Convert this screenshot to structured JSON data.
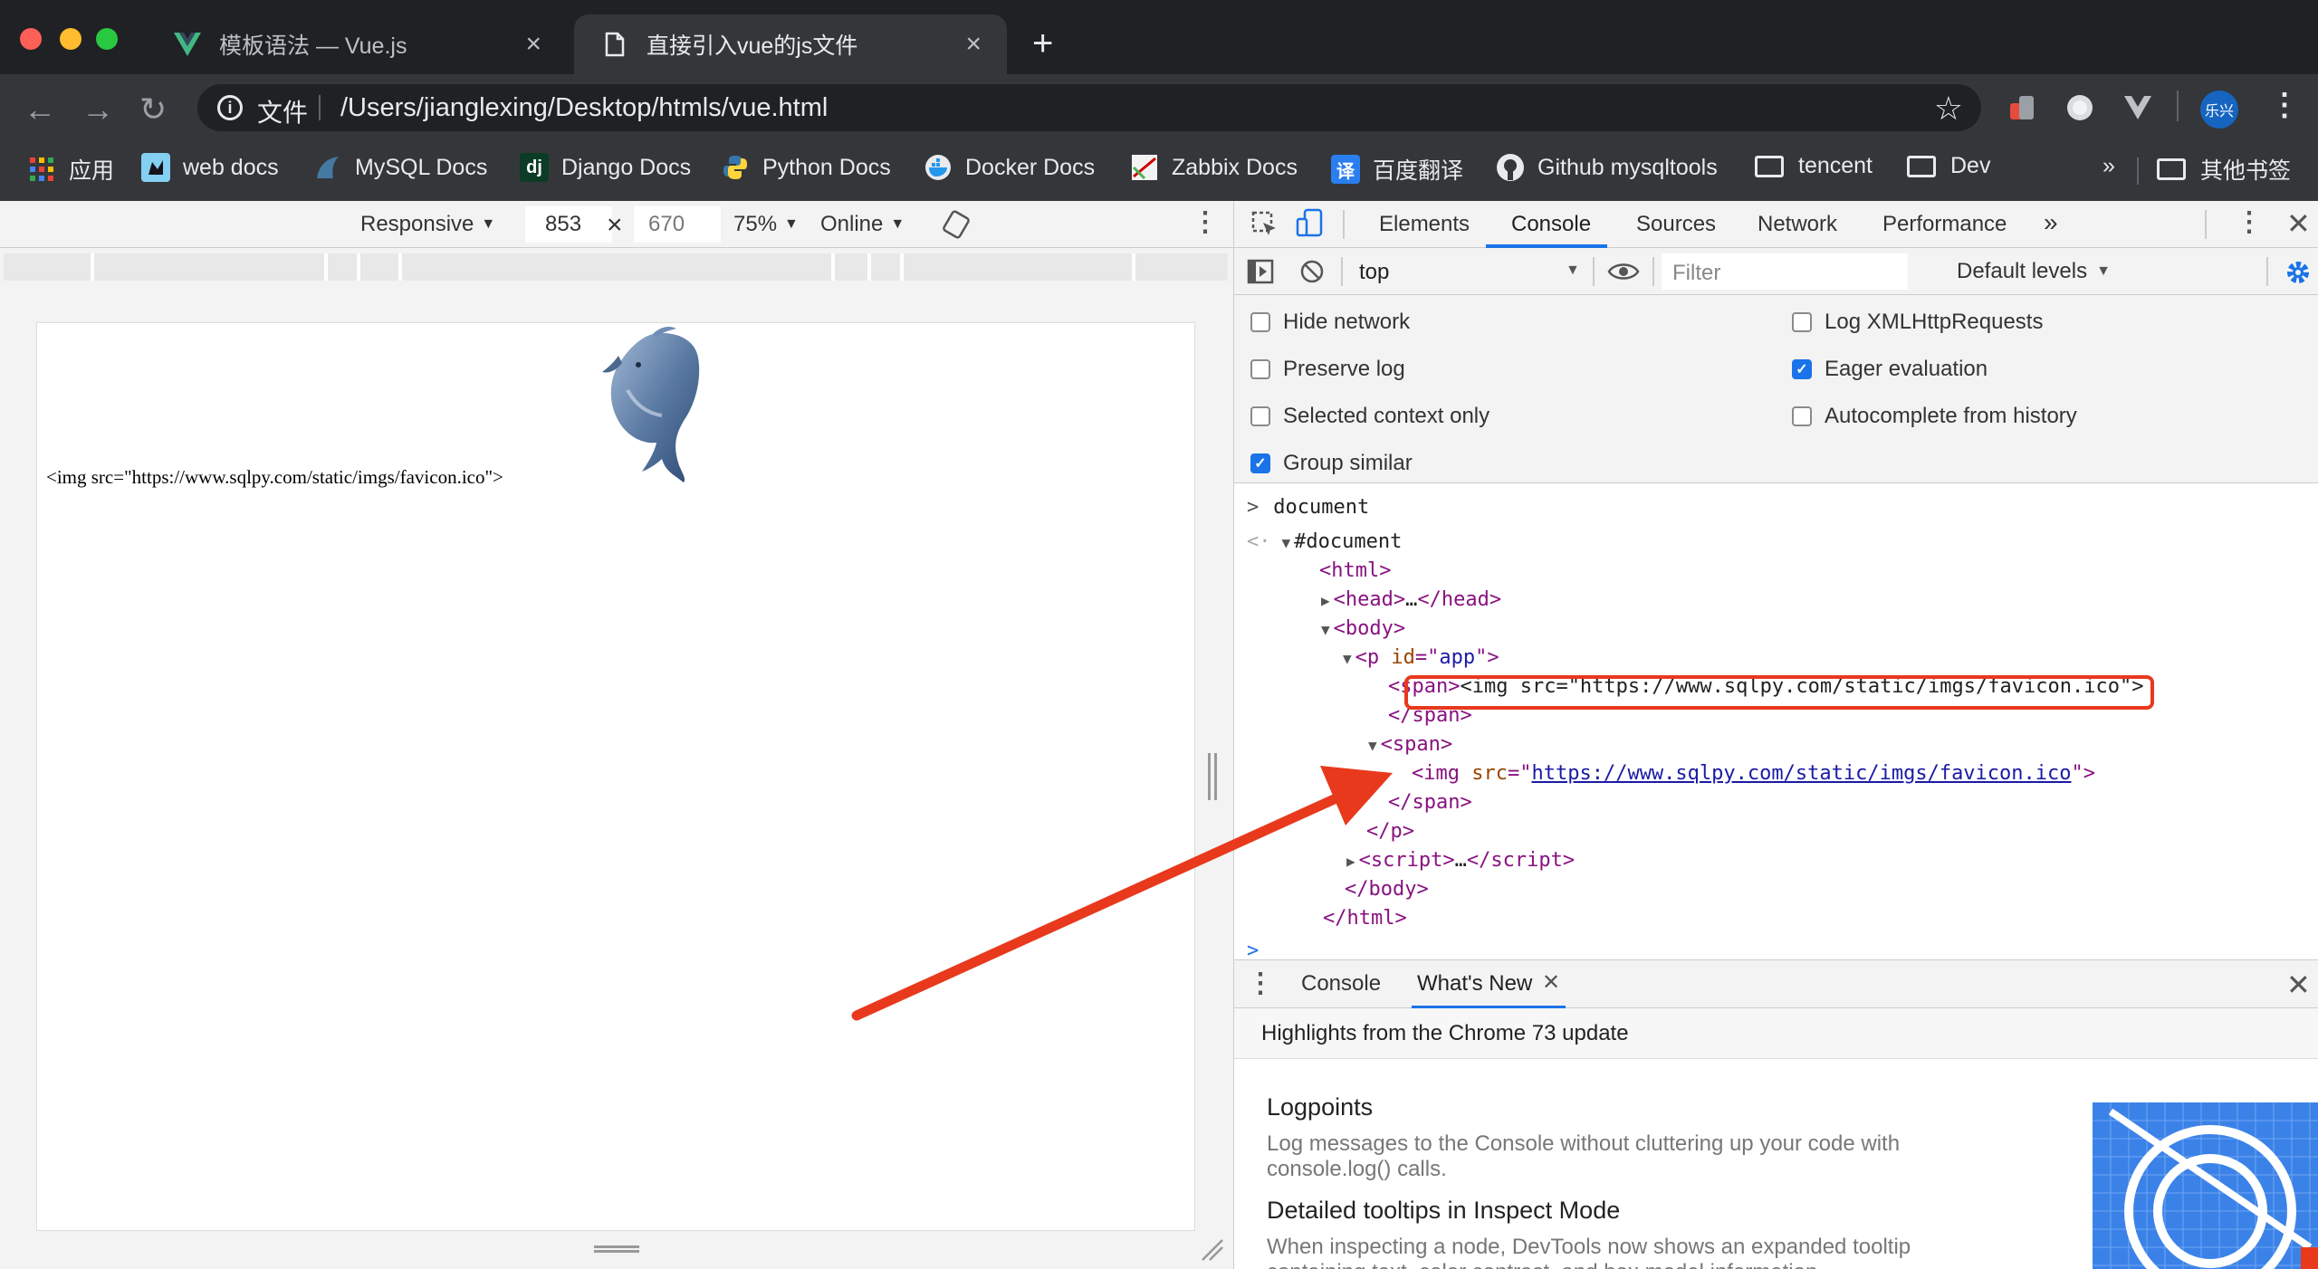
{
  "browser": {
    "tabs": [
      {
        "title": "模板语法 — Vue.js",
        "close": "×"
      },
      {
        "title": "直接引入vue的js文件",
        "close": "×"
      }
    ],
    "new_tab": "+",
    "nav": {
      "back": "←",
      "forward": "→",
      "reload": "↻"
    },
    "omnibox": {
      "info": "i",
      "scheme_label": "文件",
      "url": "/Users/jianglexing/Desktop/htmls/vue.html",
      "star": "☆"
    },
    "profile_label": "乐兴",
    "menu": "⋮"
  },
  "bookmarks": [
    {
      "label": "应用",
      "icon": "apps-grid-icon"
    },
    {
      "label": "web docs",
      "icon": "mdn-icon"
    },
    {
      "label": "MySQL Docs",
      "icon": "mysql-icon"
    },
    {
      "label": "Django Docs",
      "icon": "django-icon",
      "glyph": "dj"
    },
    {
      "label": "Python Docs",
      "icon": "python-icon"
    },
    {
      "label": "Docker Docs",
      "icon": "docker-icon"
    },
    {
      "label": "Zabbix Docs",
      "icon": "zabbix-icon"
    },
    {
      "label": "百度翻译",
      "icon": "translate-icon",
      "glyph": "译"
    },
    {
      "label": "Github mysqltools",
      "icon": "github-icon"
    },
    {
      "label": "tencent",
      "icon": "folder-icon"
    },
    {
      "label": "Dev",
      "icon": "folder-icon"
    },
    {
      "label": "»",
      "icon": "overflow-chevron"
    },
    {
      "label": "其他书签",
      "icon": "folder-icon"
    }
  ],
  "device_toolbar": {
    "mode": "Responsive",
    "width": "853",
    "times": "×",
    "height": "670",
    "zoom": "75%",
    "network": "Online",
    "caret": "▼"
  },
  "page": {
    "text": "<img src=\"https://www.sqlpy.com/static/imgs/favicon.ico\">"
  },
  "devtools": {
    "tabs": [
      "Elements",
      "Console",
      "Sources",
      "Network",
      "Performance"
    ],
    "more": "»",
    "active_tab": "Console",
    "filterbar": {
      "context": "top",
      "filter_placeholder": "Filter",
      "levels": "Default levels"
    },
    "settings": [
      {
        "label": "Hide network",
        "checked": false
      },
      {
        "label": "Preserve log",
        "checked": false
      },
      {
        "label": "Selected context only",
        "checked": false
      },
      {
        "label": "Group similar",
        "checked": true
      },
      {
        "label": "Log XMLHttpRequests",
        "checked": false
      },
      {
        "label": "Eager evaluation",
        "checked": true
      },
      {
        "label": "Autocomplete from history",
        "checked": false
      }
    ],
    "console": {
      "input": "document",
      "result_root": "#document",
      "img_url": "https://www.sqlpy.com/static/imgs/favicon.ico",
      "span_text": "<img src=\"https://www.sqlpy.com/static/imgs/favicon.ico\">"
    },
    "drawer": {
      "tabs": [
        "Console",
        "What's New"
      ],
      "highlights": "Highlights from the Chrome 73 update",
      "items": [
        {
          "title": "Logpoints",
          "desc": "Log messages to the Console without cluttering up your code with console.log() calls."
        },
        {
          "title": "Detailed tooltips in Inspect Mode",
          "desc": "When inspecting a node, DevTools now shows an expanded tooltip containing text, color contrast, and box model information."
        }
      ]
    }
  },
  "colors": {
    "annotation": "#e8391d",
    "accent": "#1a73e8"
  }
}
